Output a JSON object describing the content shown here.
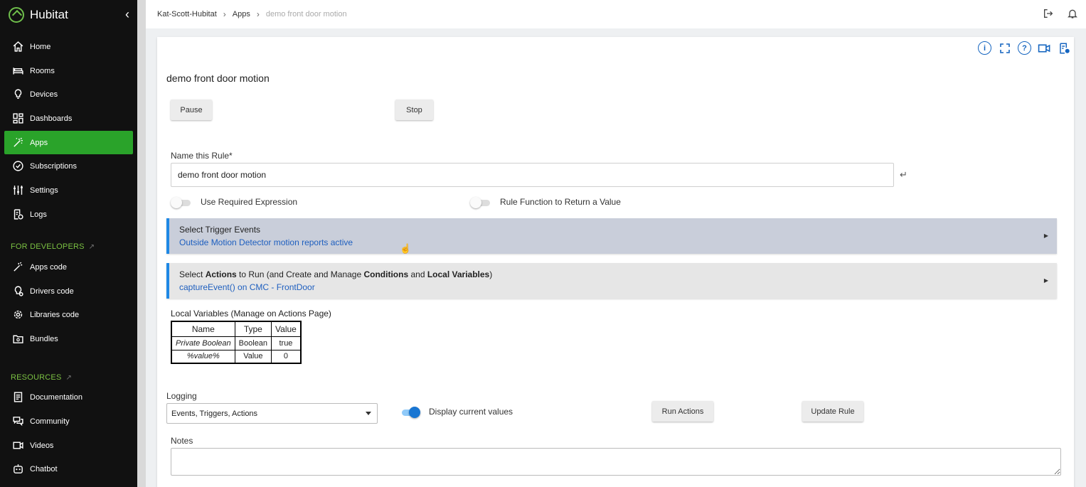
{
  "brand": {
    "name": "Hubitat"
  },
  "sidebar": {
    "items": [
      {
        "label": "Home",
        "icon": "home-icon"
      },
      {
        "label": "Rooms",
        "icon": "bed-icon"
      },
      {
        "label": "Devices",
        "icon": "lightbulb-icon"
      },
      {
        "label": "Dashboards",
        "icon": "dashboard-icon"
      },
      {
        "label": "Apps",
        "icon": "magic-wand-icon",
        "active": true
      },
      {
        "label": "Subscriptions",
        "icon": "check-circle-icon"
      },
      {
        "label": "Settings",
        "icon": "sliders-icon"
      },
      {
        "label": "Logs",
        "icon": "log-file-icon"
      }
    ],
    "developers_heading": "FOR DEVELOPERS",
    "developer_items": [
      {
        "label": "Apps code",
        "icon": "wand-code-icon"
      },
      {
        "label": "Drivers code",
        "icon": "driver-gear-icon"
      },
      {
        "label": "Libraries code",
        "icon": "library-gear-icon"
      },
      {
        "label": "Bundles",
        "icon": "bundle-icon"
      }
    ],
    "resources_heading": "RESOURCES",
    "resource_items": [
      {
        "label": "Documentation",
        "icon": "document-icon"
      },
      {
        "label": "Community",
        "icon": "chat-icon"
      },
      {
        "label": "Videos",
        "icon": "video-icon"
      },
      {
        "label": "Chatbot",
        "icon": "robot-icon"
      }
    ],
    "accent_color": "#2aa32a"
  },
  "breadcrumb": {
    "hub": "Kat-Scott-Hubitat",
    "section": "Apps",
    "current": "demo front door motion"
  },
  "app": {
    "title": "demo front door motion",
    "pause_label": "Pause",
    "stop_label": "Stop",
    "name_label": "Name this Rule*",
    "name_value": "demo front door motion",
    "required_expression_label": "Use Required Expression",
    "required_expression_on": false,
    "rule_function_label": "Rule Function to Return a Value",
    "rule_function_on": false,
    "trigger_title": "Select Trigger Events",
    "trigger_summary": "Outside Motion Detector motion reports active",
    "actions_title_1": "Select ",
    "actions_title_2": "Actions",
    "actions_title_3": " to Run (and Create and Manage ",
    "actions_title_4": "Conditions",
    "actions_title_5": " and ",
    "actions_title_6": "Local Variables",
    "actions_title_7": ")",
    "actions_summary": "captureEvent() on CMC - FrontDoor",
    "local_vars_title": "Local Variables",
    "local_vars_note": " (Manage on Actions Page)",
    "local_vars_headers": [
      "Name",
      "Type",
      "Value"
    ],
    "local_vars_rows": [
      [
        "Private Boolean",
        "Boolean",
        "true"
      ],
      [
        "%value%",
        "Value",
        "0"
      ]
    ],
    "logging_label": "Logging",
    "logging_value": "Events, Triggers, Actions",
    "display_values_label": "Display current values",
    "display_values_on": true,
    "run_actions_label": "Run Actions",
    "update_rule_label": "Update Rule",
    "notes_label": "Notes"
  }
}
